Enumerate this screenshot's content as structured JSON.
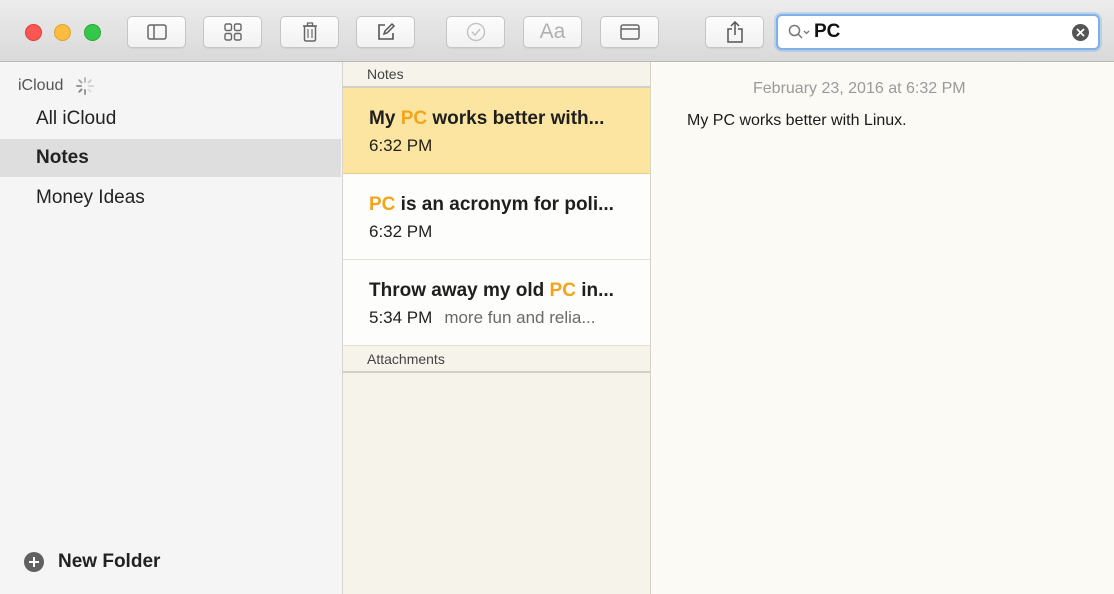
{
  "window": {
    "toolbar": {
      "search": {
        "value": "PC",
        "placeholder": ""
      },
      "format_label": "Aa"
    },
    "sidebar": {
      "account_label": "iCloud",
      "items": [
        {
          "label": "All iCloud",
          "selected": false
        },
        {
          "label": "Notes",
          "selected": true
        },
        {
          "label": "Money Ideas",
          "selected": false
        }
      ],
      "new_folder_label": "New Folder"
    },
    "note_list": {
      "section_notes": "Notes",
      "section_attachments": "Attachments",
      "notes": [
        {
          "title_pre": "My ",
          "title_hl": "PC",
          "title_post": " works better with...",
          "time": "6:32 PM",
          "snippet": "",
          "selected": true
        },
        {
          "title_pre": "",
          "title_hl": "PC",
          "title_post": " is an acronym for poli...",
          "time": "6:32 PM",
          "snippet": "",
          "selected": false
        },
        {
          "title_pre": "Throw away my old ",
          "title_hl": "PC",
          "title_post": " in...",
          "time": "5:34 PM",
          "snippet": "more fun and relia...",
          "selected": false
        }
      ]
    },
    "editor": {
      "date": "February 23, 2016 at 6:32 PM",
      "body": "My PC works better with Linux."
    },
    "colors": {
      "highlight": "#f2a51a",
      "selected_note": "#fbe5a1",
      "search_focus": "#7fb0ea"
    },
    "icons": [
      "sidebar-toggle-icon",
      "gallery-view-icon",
      "trash-icon",
      "compose-icon",
      "checklist-icon",
      "format-text-icon",
      "table-icon",
      "share-icon",
      "search-icon",
      "clear-search-icon",
      "loading-spinner-icon",
      "add-folder-icon"
    ]
  }
}
